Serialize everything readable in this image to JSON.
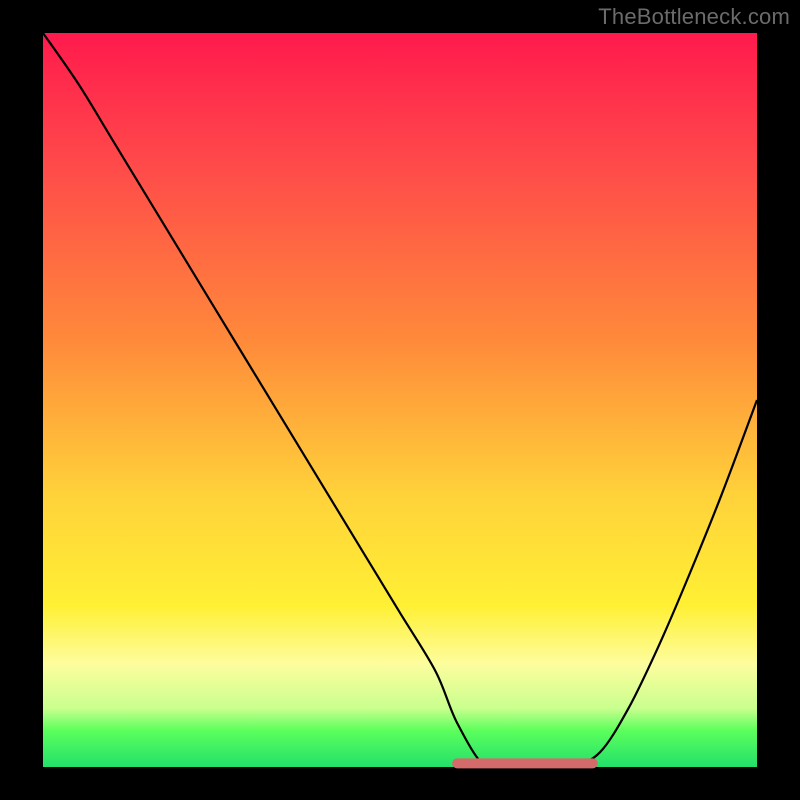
{
  "attribution": "TheBottleneck.com",
  "chart_data": {
    "type": "line",
    "title": "",
    "xlabel": "",
    "ylabel": "",
    "xlim": [
      0,
      100
    ],
    "ylim": [
      0,
      100
    ],
    "series": [
      {
        "name": "bottleneck-curve",
        "x": [
          0,
          5,
          10,
          15,
          20,
          25,
          30,
          35,
          40,
          45,
          50,
          55,
          58,
          62,
          66,
          70,
          74,
          78,
          82,
          86,
          90,
          95,
          100
        ],
        "values": [
          100,
          93,
          85,
          77,
          69,
          61,
          53,
          45,
          37,
          29,
          21,
          13,
          6,
          0,
          0,
          0,
          0,
          2,
          8,
          16,
          25,
          37,
          50
        ]
      },
      {
        "name": "optimal-range-highlight",
        "x": [
          58,
          62,
          66,
          70,
          74,
          77
        ],
        "values": [
          0.5,
          0.5,
          0.5,
          0.5,
          0.5,
          0.5
        ]
      }
    ],
    "notes": "Axes are unlabeled in the source image; x and y normalized to 0–100. The curve descends steeply from top-left, reaches ~0 around x≈62–77 (highlighted segment), then rises toward the right edge reaching roughly 50% height."
  }
}
